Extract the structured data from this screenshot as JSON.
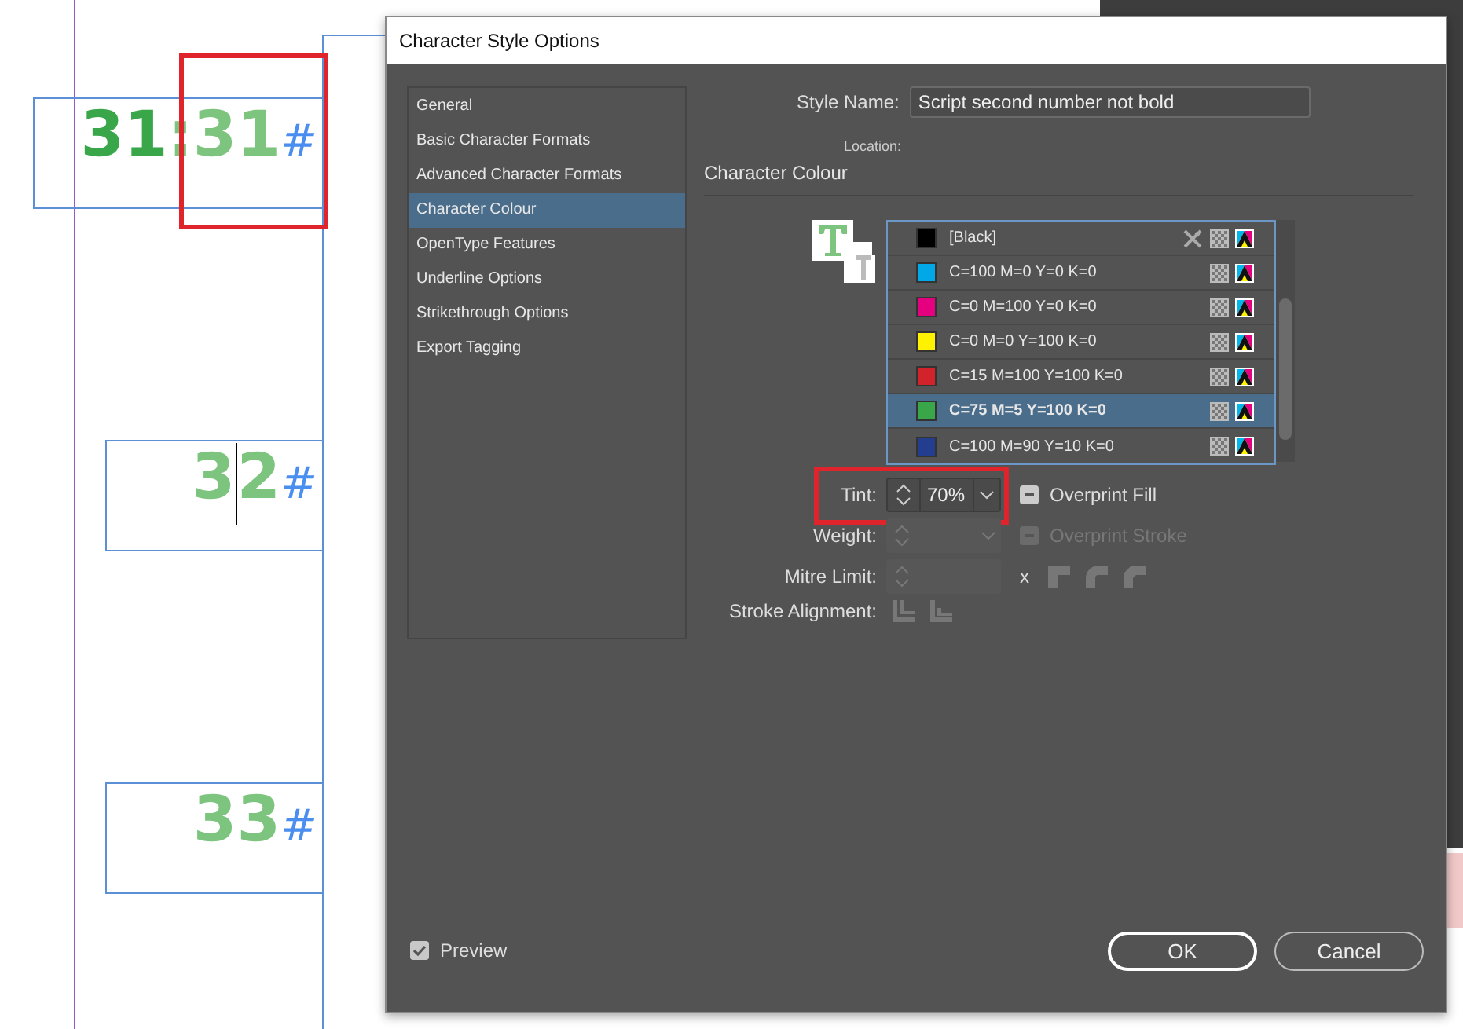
{
  "canvas": {
    "frames": [
      {
        "runs": [
          {
            "text": "31",
            "kind": "bold"
          },
          {
            "text": ":31",
            "kind": "tint"
          },
          {
            "text": "#",
            "kind": "marker"
          }
        ],
        "highlighted": true,
        "cursor": false
      },
      {
        "runs": [
          {
            "text": "3",
            "kind": "tint"
          },
          {
            "text": "2",
            "kind": "tint"
          },
          {
            "text": "#",
            "kind": "marker"
          }
        ],
        "highlighted": false,
        "cursor": true
      },
      {
        "runs": [
          {
            "text": "33",
            "kind": "tint"
          },
          {
            "text": "#",
            "kind": "marker"
          }
        ],
        "highlighted": false,
        "cursor": false
      }
    ]
  },
  "dialog": {
    "title": "Character Style Options",
    "sections": [
      {
        "label": "General",
        "selected": false
      },
      {
        "label": "Basic Character Formats",
        "selected": false
      },
      {
        "label": "Advanced Character Formats",
        "selected": false
      },
      {
        "label": "Character Colour",
        "selected": true
      },
      {
        "label": "OpenType Features",
        "selected": false
      },
      {
        "label": "Underline Options",
        "selected": false
      },
      {
        "label": "Strikethrough Options",
        "selected": false
      },
      {
        "label": "Export Tagging",
        "selected": false
      }
    ],
    "style_name": {
      "label": "Style Name:",
      "value": "Script second number not bold"
    },
    "location_label": "Location:",
    "section_title": "Character Colour",
    "swatches": [
      {
        "name": "[Black]",
        "color": "#000000",
        "selected": false,
        "locked": true
      },
      {
        "name": "C=100 M=0 Y=0 K=0",
        "color": "#00a8e8",
        "selected": false,
        "locked": false
      },
      {
        "name": "C=0 M=100 Y=0 K=0",
        "color": "#e4007f",
        "selected": false,
        "locked": false
      },
      {
        "name": "C=0 M=0 Y=100 K=0",
        "color": "#fff200",
        "selected": false,
        "locked": false
      },
      {
        "name": "C=15 M=100 Y=100 K=0",
        "color": "#d2232a",
        "selected": false,
        "locked": false
      },
      {
        "name": "C=75 M=5 Y=100 K=0",
        "color": "#3aa64a",
        "selected": true,
        "locked": false
      },
      {
        "name": "C=100 M=90 Y=10 K=0",
        "color": "#233d8f",
        "selected": false,
        "locked": false
      }
    ],
    "tint": {
      "label": "Tint:",
      "value": "70%",
      "highlighted": true
    },
    "overprint_fill": {
      "label": "Overprint Fill",
      "disabled": false
    },
    "weight": {
      "label": "Weight:"
    },
    "overprint_stroke": {
      "label": "Overprint Stroke",
      "disabled": true
    },
    "mitre_limit": {
      "label": "Mitre Limit:",
      "suffix": "x"
    },
    "stroke_alignment": {
      "label": "Stroke Alignment:"
    },
    "preview": {
      "label": "Preview",
      "checked": true
    },
    "buttons": [
      {
        "label": "OK",
        "kind": "default"
      },
      {
        "label": "Cancel",
        "kind": "normal"
      }
    ]
  }
}
